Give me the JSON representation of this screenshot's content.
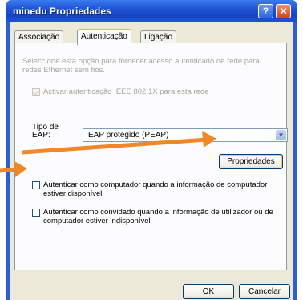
{
  "window": {
    "title": "minedu Propriedades"
  },
  "titlebar": {
    "help_glyph": "?",
    "close_glyph": "✕"
  },
  "tabs": [
    {
      "label": "Associação"
    },
    {
      "label": "Autenticação"
    },
    {
      "label": "Ligação"
    }
  ],
  "auth": {
    "description": "Seleccione esta opção para fornecer acesso autenticado de rede para redes Ethernet sem fios.",
    "ieee_label": "Activar autenticação IEEE 802.1X para esta rede",
    "ieee_checked": true,
    "eap_label_line1": "Tipo de",
    "eap_label_line2": "EAP:",
    "eap_value": "EAP protegido (PEAP)",
    "properties_button": "Propriedades",
    "computer_auth_label": "Autenticar como computador quando a informação de computador estiver disponível",
    "computer_auth_checked": false,
    "guest_auth_label": "Autenticar como convidado quando a informação de utilizador ou de computador estiver indisponível",
    "guest_auth_checked": false
  },
  "footer": {
    "ok_label": "OK",
    "cancel_label": "Cancelar"
  },
  "colors": {
    "titlebar": "#1c4fd0",
    "dialog": "#ece9d8",
    "arrow": "#f0882a"
  }
}
